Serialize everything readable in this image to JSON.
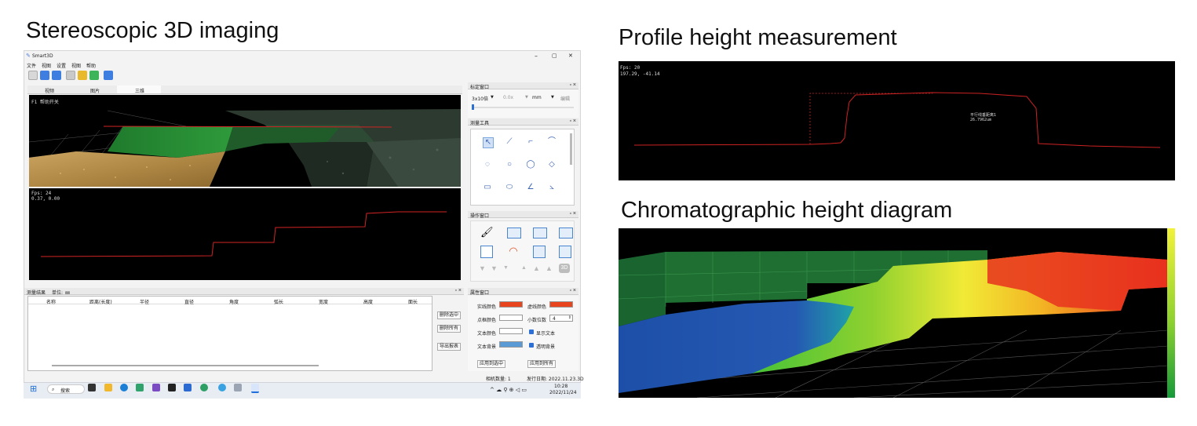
{
  "titles": {
    "stereo": "Stereoscopic 3D imaging",
    "profile": "Profile height measurement",
    "chroma": "Chromatographic height diagram"
  },
  "app": {
    "name": "Smart3D",
    "window_controls": [
      "–",
      "▢",
      "✕"
    ],
    "menu": [
      "文件",
      "视图",
      "设置",
      "视图",
      "帮助"
    ],
    "tabs": [
      "视频",
      "图片",
      "三维"
    ],
    "view3d_label": "F1 帮助开关",
    "profile_fps": "Fps: 24",
    "profile_coord": "0.37, 0.00"
  },
  "calib": {
    "title": "标定窗口",
    "magnification": "3x10倍",
    "zoom": "0.0x",
    "unit": "mm",
    "edit_label": "编辑"
  },
  "measure_tools": {
    "title": "测量工具"
  },
  "ops": {
    "title": "操作窗口",
    "label_3d": "3D"
  },
  "results": {
    "title": "测量结果",
    "unit_label": "单位:",
    "unit_value": "㎜",
    "columns": [
      "名称",
      "距离(长度)",
      "半径",
      "直径",
      "角度",
      "弧长",
      "宽度",
      "高度",
      "面长"
    ],
    "buttons": [
      "删除选中",
      "删除所有",
      "导出报表"
    ]
  },
  "props": {
    "title": "属性窗口",
    "solid_color_label": "实线颜色",
    "dashed_color_label": "虚线颜色",
    "point_color_label": "点框颜色",
    "decimals_label": "小数位数",
    "decimals_value": "4",
    "text_color_label": "文本颜色",
    "show_text_label": "显示文本",
    "text_bg_label": "文本背景",
    "transparent_bg_label": "透明背景",
    "apply_selected": "应用到选中",
    "apply_all": "应用到所有",
    "solid_color": "#e8441e",
    "dashed_color": "#e8441e",
    "text_bg_color": "#5b9bd5"
  },
  "statusbar": {
    "camera_count": "相机数量: 1",
    "release_date": "发行日期: 2022.11.23.3D"
  },
  "taskbar": {
    "search": "搜索",
    "time": "10:28",
    "date": "2022/11/24"
  },
  "profile_panel": {
    "fps": "Fps: 20",
    "coord": "197.29, -41.14",
    "annot_label": "平行线垂距离1",
    "annot_value": "26.7962um"
  }
}
